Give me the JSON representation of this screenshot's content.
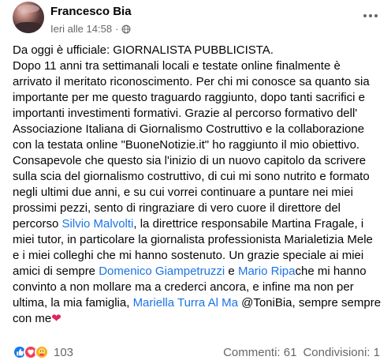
{
  "header": {
    "author": "Francesco Bia",
    "timestamp": "Ieri alle 14:58",
    "separator": "·",
    "privacy_icon": "globe-icon",
    "more_icon": "more-options-icon"
  },
  "post": {
    "lines": [
      [
        {
          "t": "Da oggi è ufficiale: GIORNALISTA PUBBLICISTA."
        }
      ],
      [
        {
          "t": "Dopo 11 anni tra settimanali locali e testate online finalmente è"
        }
      ],
      [
        {
          "t": "arrivato il meritato riconoscimento. Per chi mi conosce sa quanto sia"
        }
      ],
      [
        {
          "t": "importante per me questo traguardo raggiunto, dopo tanti sacrifici e"
        }
      ],
      [
        {
          "t": "importanti investimenti formativi. Grazie al percorso formativo dell'"
        }
      ],
      [
        {
          "t": "Associazione Italiana di Giornalismo Costruttivo e la collaborazione"
        }
      ],
      [
        {
          "t": "con la testata online \"BuoneNotizie.it\" ho raggiunto il mio obiettivo."
        }
      ],
      [
        {
          "t": "Consapevole che questo sia l'inizio di un nuovo capitolo da scrivere"
        }
      ],
      [
        {
          "t": "sulla scia del giornalismo costruttivo, di cui mi sono nutrito e formato"
        }
      ],
      [
        {
          "t": "negli ultimi due anni, e su cui vorrei continuare a puntare nei miei"
        }
      ],
      [
        {
          "t": "prossimi pezzi, sento di ringraziare di vero cuore il direttore del"
        }
      ],
      [
        {
          "t": "percorso "
        },
        {
          "t": "Silvio Malvolti",
          "m": true
        },
        {
          "t": ", la direttrice responsabile Martina Fragale, i"
        }
      ],
      [
        {
          "t": "miei tutor, in particolare la giornalista professionista Marialetizia Mele"
        }
      ],
      [
        {
          "t": "e i miei colleghi che mi hanno sostenuto. Un grazie speciale ai miei"
        }
      ],
      [
        {
          "t": "amici di sempre "
        },
        {
          "t": "Domenico Giampetruzzi",
          "m": true
        },
        {
          "t": " e "
        },
        {
          "t": "Mario Ripa",
          "m": true
        },
        {
          "t": "che mi hanno"
        }
      ],
      [
        {
          "t": "convinto a non mollare ma a crederci ancora, e infine ma non per"
        }
      ],
      [
        {
          "t": "ultima, la mia famiglia, "
        },
        {
          "t": "Mariella Turra Al Ma",
          "m": true
        },
        {
          "t": " @ToniBia, sempre sempre"
        }
      ],
      [
        {
          "t": "con me"
        },
        {
          "t": "❤",
          "h": true
        }
      ]
    ]
  },
  "footer": {
    "reaction_icons": [
      "like-icon",
      "love-icon",
      "care-icon"
    ],
    "reaction_count": "103",
    "comments": "Commenti: 61",
    "shares": "Condivisioni: 1",
    "colors": {
      "like": "#1877f2",
      "love": "#f33e58",
      "care": "#f7b125",
      "mention": "#1b74e4"
    }
  }
}
